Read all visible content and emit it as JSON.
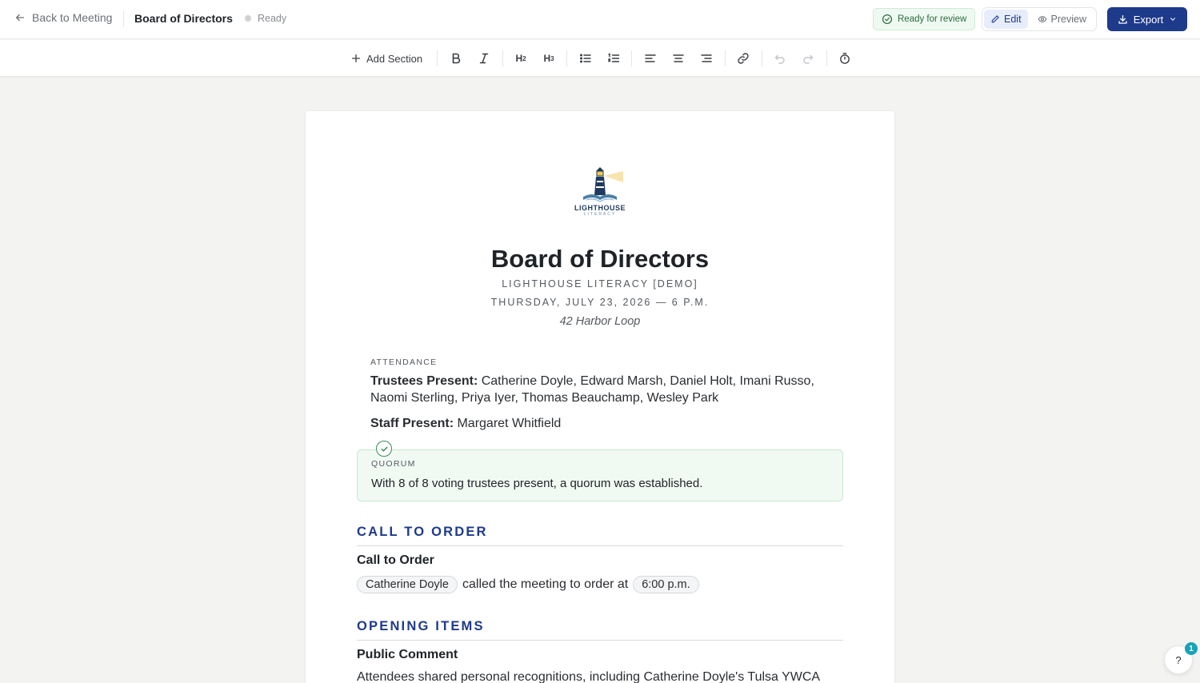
{
  "header": {
    "back_label": "Back to Meeting",
    "title": "Board of Directors",
    "status": "Ready",
    "review_badge": "Ready for review",
    "edit_label": "Edit",
    "preview_label": "Preview",
    "export_label": "Export"
  },
  "toolbar": {
    "add_section": "Add Section",
    "bold": "B",
    "italic": "I",
    "h2": "H",
    "h2_sub": "2",
    "h3": "H",
    "h3_sub": "3"
  },
  "document": {
    "logo_text": "LIGHTHOUSE",
    "logo_sub": "LITERACY",
    "title": "Board of Directors",
    "org": "LIGHTHOUSE LITERACY [DEMO]",
    "date": "THURSDAY, JULY 23, 2026  —  6 P.M.",
    "location": "42 Harbor Loop",
    "attendance": {
      "label": "ATTENDANCE",
      "trustees_label": "Trustees Present:",
      "trustees": " Catherine Doyle, Edward Marsh, Daniel Holt, Imani Russo, Naomi Sterling, Priya Iyer, Thomas Beauchamp, Wesley Park",
      "staff_label": "Staff Present:",
      "staff": " Margaret Whitfield"
    },
    "quorum": {
      "label": "QUORUM",
      "text": "With 8 of 8 voting trustees present, a quorum was established."
    },
    "sections": [
      {
        "heading": "CALL TO ORDER",
        "subheading": "Call to Order",
        "chip_person": "Catherine Doyle",
        "text": "called the meeting to order at",
        "chip_time": "6:00 p.m."
      },
      {
        "heading": "OPENING ITEMS",
        "subheading": "Public Comment",
        "text": "Attendees shared personal recognitions, including Catherine Doyle's Tulsa YWCA"
      }
    ]
  },
  "help": {
    "label": "?",
    "badge": "1"
  },
  "colors": {
    "accent": "#1e3a8a",
    "success_bg": "#f0faf3",
    "success_border": "#c7e6cf"
  }
}
